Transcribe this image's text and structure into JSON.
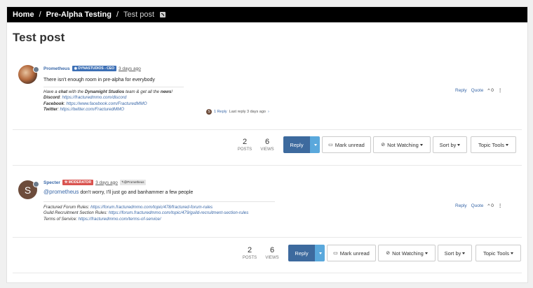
{
  "breadcrumb": {
    "home": "Home",
    "category": "Pre-Alpha Testing",
    "current": "Test post"
  },
  "page_title": "Test post",
  "posts": [
    {
      "username": "Prometheus",
      "badge": "DYNASTUDIOS - CEO",
      "timestamp": "3 days ago",
      "body": "There isn't enough room in pre-alpha for everybody",
      "signature": {
        "line1_pre": "Have a ",
        "line1_chat": "chat",
        "line1_mid": " with the ",
        "line1_studio": "Dynamight Studios",
        "line1_post": " team & get all the ",
        "line1_news": "news",
        "line1_end": "!",
        "discord_label": "Discord",
        "discord_url": "https://fracturedmmo.com/discord",
        "facebook_label": "Facebook",
        "facebook_url": "https://www.facebook.com/FracturedMMO",
        "twitter_label": "Twitter",
        "twitter_url": "https://twitter.com/FracturedMMO"
      },
      "reply_summary": {
        "avatar_letter": "S",
        "count": "1 Reply",
        "last": "Last reply 3 days ago"
      },
      "actions": {
        "reply": "Reply",
        "quote": "Quote",
        "votes": "0"
      }
    },
    {
      "username": "Specter",
      "avatar_letter": "S",
      "badge": "MODERATOR",
      "timestamp": "3 days ago",
      "reply_to": "@Prometheus",
      "mention": "@prometheus",
      "body": "don't worry, I'll just go and banhammer a few people",
      "signature": {
        "rules_label": "Fractured Forum Rules",
        "rules_url": "https://forum.fracturedmmo.com/topic/478/fractured-forum-rules",
        "guild_label": "Guild Recruitment Section Rules",
        "guild_url": "https://forum.fracturedmmo.com/topic/479/guild-recruitment-section-rules",
        "tos_label": "Terms of Service",
        "tos_url": "https://fracturedmmo.com/terms-of-service/"
      },
      "actions": {
        "reply": "Reply",
        "quote": "Quote",
        "votes": "0"
      }
    }
  ],
  "toolbar": {
    "posts_count": "2",
    "posts_label": "POSTS",
    "views_count": "6",
    "views_label": "VIEWS",
    "reply": "Reply",
    "mark_unread": "Mark unread",
    "not_watching": "Not Watching",
    "sort_by": "Sort by",
    "topic_tools": "Topic Tools"
  },
  "colors": {
    "accent_blue": "#3d6a9e",
    "caret_blue": "#5aa8dc",
    "link": "#3a68a8",
    "moderator_red": "#d9534f"
  }
}
